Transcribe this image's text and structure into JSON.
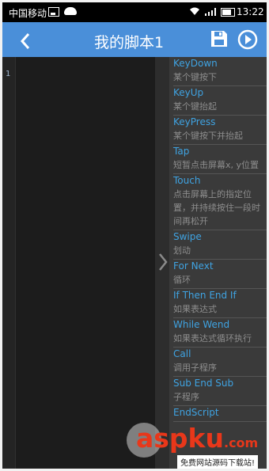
{
  "status_bar": {
    "carrier": "中国移动",
    "time": "13:22"
  },
  "header": {
    "title": "我的脚本1",
    "back_icon": "chevron-left-icon",
    "save_icon": "floppy-disk-icon",
    "run_icon": "play-circle-icon"
  },
  "editor": {
    "line_numbers": [
      "1"
    ]
  },
  "commands": [
    {
      "name": "KeyDown",
      "desc": "某个键按下"
    },
    {
      "name": "KeyUp",
      "desc": "某个键抬起"
    },
    {
      "name": "KeyPress",
      "desc": "某个键按下并抬起"
    },
    {
      "name": "Tap",
      "desc": "短暂点击屏幕x, y位置"
    },
    {
      "name": "Touch",
      "desc": "点击屏幕上的指定位置，并持续按住一段时间再松开"
    },
    {
      "name": "Swipe",
      "desc": "划动"
    },
    {
      "name": "For Next",
      "desc": "循环"
    },
    {
      "name": "If Then End If",
      "desc": "如果表达式"
    },
    {
      "name": "While Wend",
      "desc": "如果表达式循环执行"
    },
    {
      "name": "Call",
      "desc": "调用子程序"
    },
    {
      "name": "Sub End Sub",
      "desc": "子程序"
    },
    {
      "name": "EndScript",
      "desc": ""
    }
  ],
  "watermark": {
    "logo_text": "aspku",
    "logo_tld": ".com",
    "tagline": "免费网站源码下载站!"
  },
  "colors": {
    "accent": "#4a8fd9",
    "command_name": "#3fa3e2",
    "command_desc": "#8d8d8d",
    "watermark_red": "#e8371a"
  }
}
